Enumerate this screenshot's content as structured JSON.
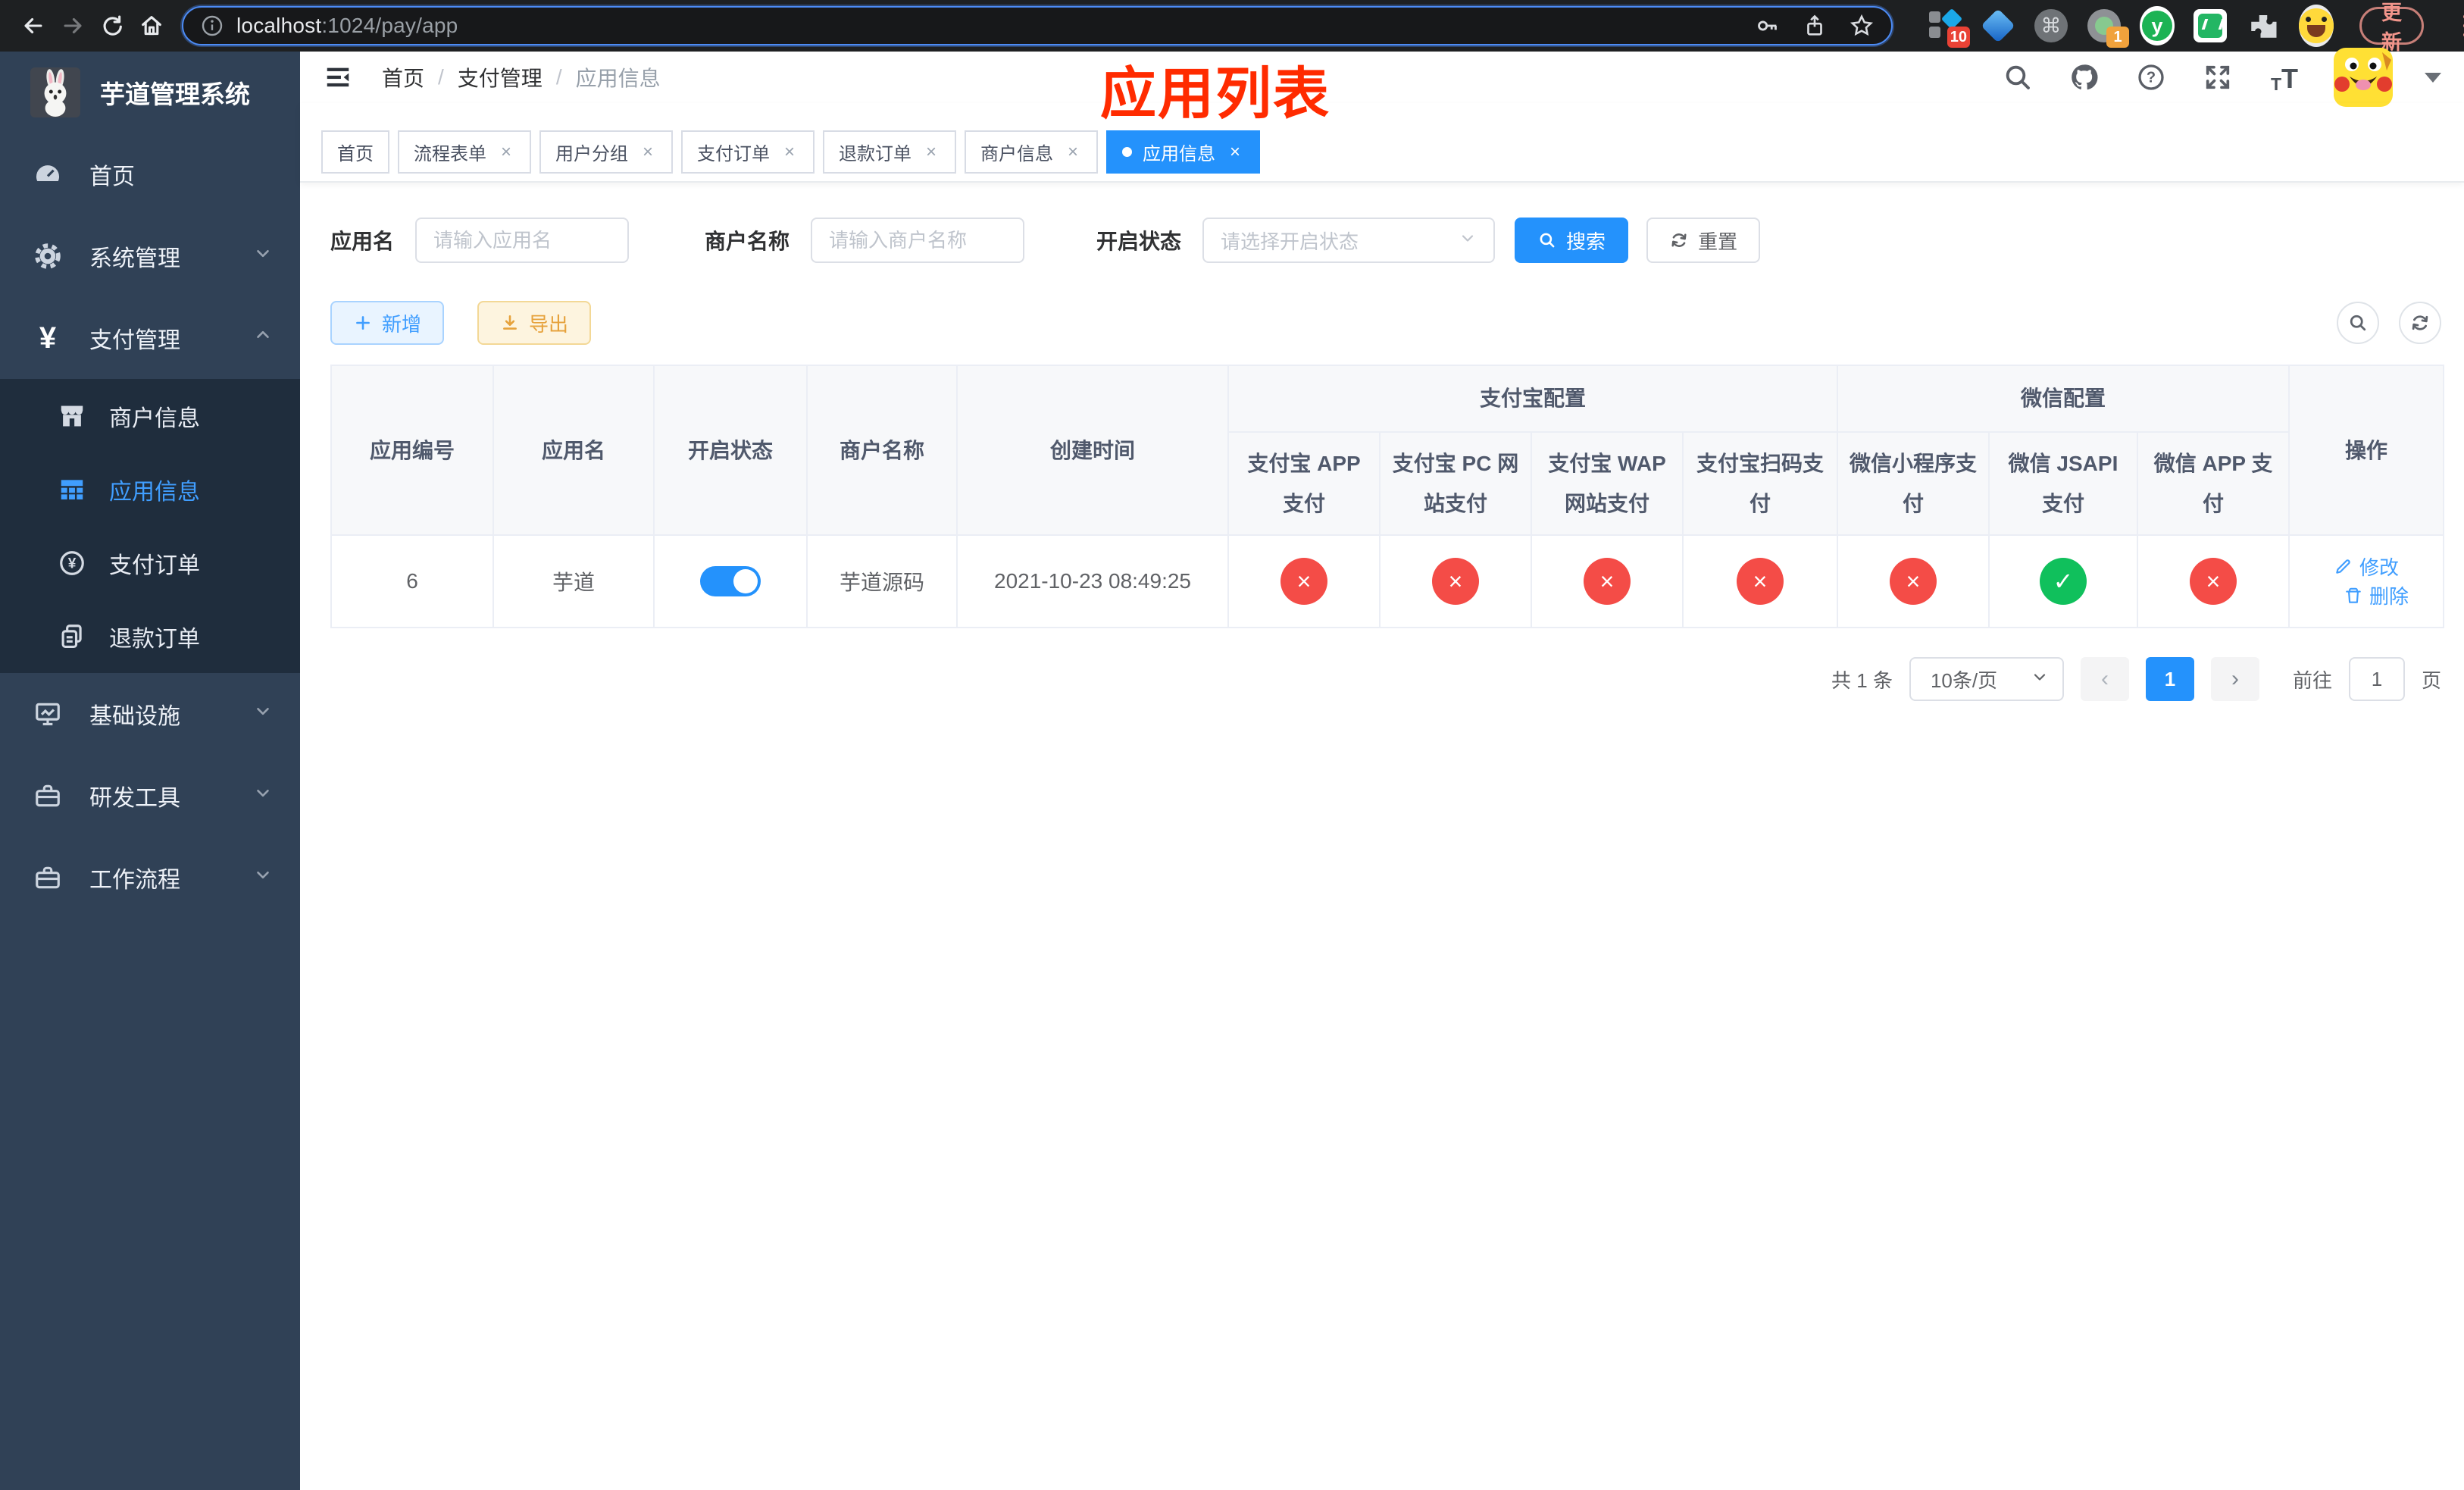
{
  "colors": {
    "accent": "#409eff",
    "danger": "#f44c47",
    "success": "#10c05c",
    "annotation": "#ff2b00",
    "export_orange": "#e6a23c"
  },
  "browser": {
    "url_host": "localhost",
    "url_path": ":1024/pay/app",
    "ext_badge_pin": "10",
    "ext_badge_rec": "1",
    "update_label": "更新"
  },
  "sidebar": {
    "title": "芋道管理系统",
    "home": "首页",
    "system": "系统管理",
    "payment": "支付管理",
    "merchant": "商户信息",
    "app_info": "应用信息",
    "pay_order": "支付订单",
    "refund_order": "退款订单",
    "infra": "基础设施",
    "dev_tools": "研发工具",
    "workflow": "工作流程"
  },
  "header": {
    "breadcrumb": {
      "home": "首页",
      "level2": "支付管理",
      "current": "应用信息",
      "separator": "/"
    },
    "annotation": "应用列表"
  },
  "tabs": [
    {
      "label": "首页",
      "closable": false,
      "active": false
    },
    {
      "label": "流程表单",
      "closable": true,
      "active": false
    },
    {
      "label": "用户分组",
      "closable": true,
      "active": false
    },
    {
      "label": "支付订单",
      "closable": true,
      "active": false
    },
    {
      "label": "退款订单",
      "closable": true,
      "active": false
    },
    {
      "label": "商户信息",
      "closable": true,
      "active": false
    },
    {
      "label": "应用信息",
      "closable": true,
      "active": true
    }
  ],
  "filters": {
    "app_name_label": "应用名",
    "app_name_placeholder": "请输入应用名",
    "merchant_label": "商户名称",
    "merchant_placeholder": "请输入商户名称",
    "status_label": "开启状态",
    "status_placeholder": "请选择开启状态",
    "search_label": "搜索",
    "reset_label": "重置"
  },
  "toolbar": {
    "add_label": "新增",
    "export_label": "导出"
  },
  "table": {
    "col_app_id": "应用编号",
    "col_app_name": "应用名",
    "col_status": "开启状态",
    "col_merchant": "商户名称",
    "col_created": "创建时间",
    "group_alipay": "支付宝配置",
    "group_wechat": "微信配置",
    "col_alipay_app": "支付宝 APP 支付",
    "col_alipay_pc": "支付宝 PC 网站支付",
    "col_alipay_wap": "支付宝 WAP 网站支付",
    "col_alipay_qr": "支付宝扫码支付",
    "col_wx_mini": "微信小程序支付",
    "col_wx_jsapi": "微信 JSAPI 支付",
    "col_wx_app": "微信 APP 支付",
    "col_actions": "操作",
    "row": {
      "app_id": "6",
      "app_name": "芋道",
      "status_on": true,
      "merchant": "芋道源码",
      "created": "2021-10-23 08:49:25",
      "configs": [
        false,
        false,
        false,
        false,
        false,
        true,
        false
      ],
      "edit_label": "修改",
      "delete_label": "删除"
    }
  },
  "pagination": {
    "total": "共 1 条",
    "page_size": "10条/页",
    "current_page": "1",
    "goto_label": "前往",
    "goto_value": "1",
    "page_suffix": "页"
  }
}
